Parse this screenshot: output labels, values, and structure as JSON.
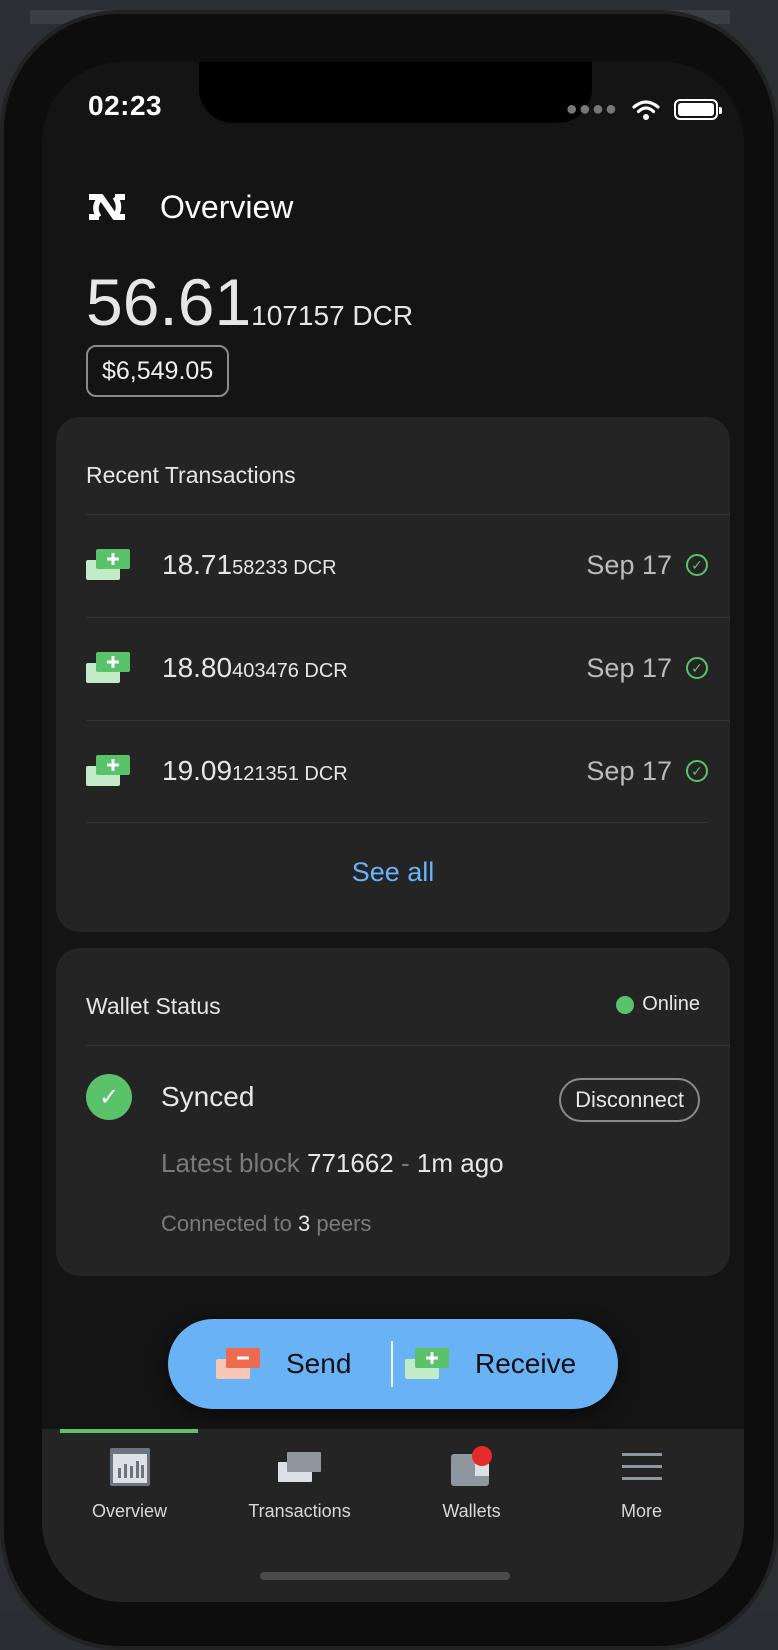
{
  "status_bar": {
    "time": "02:23"
  },
  "header": {
    "title": "Overview"
  },
  "balance": {
    "main": "56.61",
    "fraction": "107157 DCR",
    "usd": "$6,549.05"
  },
  "recent_transactions": {
    "title": "Recent Transactions",
    "items": [
      {
        "amount_main": "18.71",
        "amount_fraction": "58233 DCR",
        "date": "Sep 17",
        "status": "confirmed"
      },
      {
        "amount_main": "18.80",
        "amount_fraction": "403476 DCR",
        "date": "Sep 17",
        "status": "confirmed"
      },
      {
        "amount_main": "19.09",
        "amount_fraction": "121351 DCR",
        "date": "Sep 17",
        "status": "confirmed"
      }
    ],
    "see_all_label": "See all"
  },
  "wallet_status": {
    "title": "Wallet Status",
    "online_label": "Online",
    "synced_label": "Synced",
    "disconnect_label": "Disconnect",
    "latest_block_prefix": "Latest block",
    "latest_block_number": "771662",
    "latest_block_sep": "-",
    "latest_block_time": "1m ago",
    "connected_prefix": "Connected to",
    "peer_count": "3",
    "peers_suffix": "peers"
  },
  "actions": {
    "send_label": "Send",
    "receive_label": "Receive"
  },
  "tabs": [
    {
      "label": "Overview",
      "icon": "chart-icon",
      "active": true
    },
    {
      "label": "Transactions",
      "icon": "transactions-icon",
      "active": false
    },
    {
      "label": "Wallets",
      "icon": "wallet-icon",
      "active": false,
      "badge": true
    },
    {
      "label": "More",
      "icon": "menu-icon",
      "active": false
    }
  ],
  "colors": {
    "accent_blue": "#6ab2f6",
    "success_green": "#59c26a",
    "send_red": "#ee6a4e",
    "badge_red": "#e52a2a",
    "background": "#141414",
    "card": "#242424"
  }
}
